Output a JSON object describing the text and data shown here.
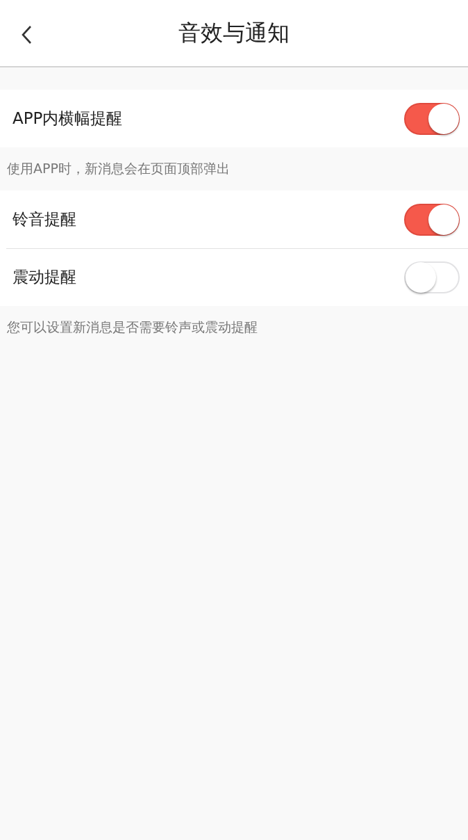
{
  "header": {
    "title": "音效与通知"
  },
  "groups": [
    {
      "items": [
        {
          "label": "APP内横幅提醒",
          "on": true
        }
      ],
      "note": "使用APP时，新消息会在页面顶部弹出"
    },
    {
      "items": [
        {
          "label": "铃音提醒",
          "on": true
        },
        {
          "label": "震动提醒",
          "on": false
        }
      ],
      "note": "您可以设置新消息是否需要铃声或震动提醒"
    }
  ]
}
